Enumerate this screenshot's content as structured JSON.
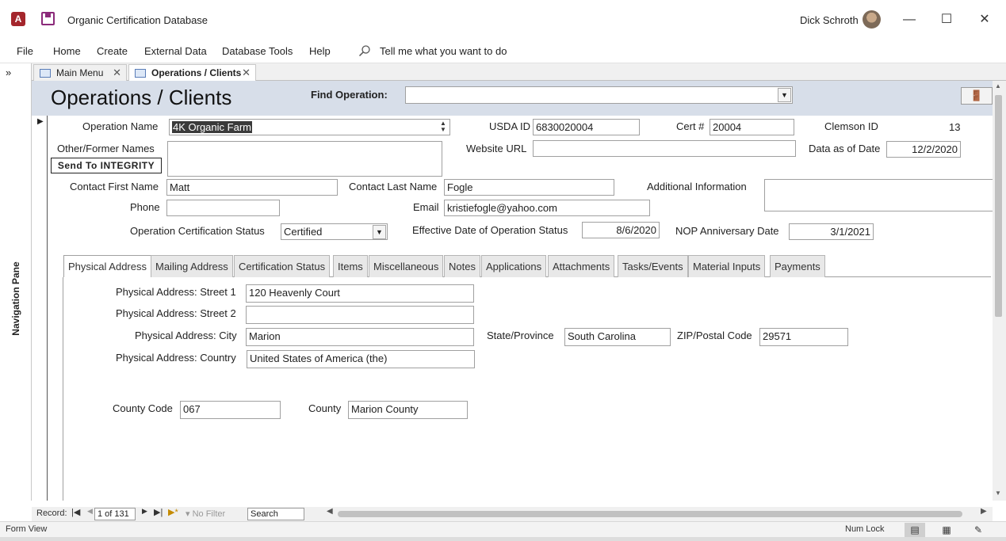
{
  "window": {
    "title": "Organic Certification Database",
    "user_name": "Dick Schroth",
    "app_icon_letter": "A"
  },
  "menu": {
    "items": [
      "File",
      "Home",
      "Create",
      "External Data",
      "Database Tools",
      "Help"
    ],
    "tell_me": "Tell me what you want to do"
  },
  "nav_pane": {
    "label": "Navigation Pane",
    "toggle": "»"
  },
  "doc_tabs": [
    {
      "label": "Main Menu",
      "active": false
    },
    {
      "label": "Operations / Clients",
      "active": true
    }
  ],
  "form": {
    "title": "Operations / Clients",
    "find_operation_label": "Find Operation:",
    "find_operation_value": ""
  },
  "record": {
    "operation_name_label": "Operation Name",
    "operation_name": "4K Organic Farm",
    "usda_id_label": "USDA ID",
    "usda_id": "6830020004",
    "cert_label": "Cert #",
    "cert": "20004",
    "clemson_id_label": "Clemson ID",
    "clemson_id": "13",
    "other_names_label": "Other/Former Names",
    "send_integrity_button": "Send To INTEGRITY",
    "other_names": "",
    "website_label": "Website URL",
    "website": "",
    "data_as_of_label": "Data as of Date",
    "data_as_of": "12/2/2020",
    "contact_first_label": "Contact First Name",
    "contact_first": "Matt",
    "contact_last_label": "Contact Last Name",
    "contact_last": "Fogle",
    "additional_info_label": "Additional Information",
    "additional_info": "",
    "phone_label": "Phone",
    "phone": "",
    "email_label": "Email",
    "email": "kristiefogle@yahoo.com",
    "cert_status_label": "Operation Certification Status",
    "cert_status": "Certified",
    "effective_date_label": "Effective Date of Operation Status",
    "effective_date": "8/6/2020",
    "nop_anniv_label": "NOP Anniversary Date",
    "nop_anniv": "3/1/2021"
  },
  "tabs": [
    "Physical Address",
    "Mailing Address",
    "Certification Status",
    "Items",
    "Miscellaneous",
    "Notes",
    "Applications",
    "Attachments",
    "Tasks/Events",
    "Material Inputs",
    "Payments"
  ],
  "physical_address": {
    "street1_label": "Physical Address: Street 1",
    "street1": "120 Heavenly Court",
    "street2_label": "Physical Address: Street 2",
    "street2": "",
    "city_label": "Physical Address: City",
    "city": "Marion",
    "state_label": "State/Province",
    "state": "South Carolina",
    "zip_label": "ZIP/Postal Code",
    "zip": "29571",
    "country_label": "Physical Address: Country",
    "country": "United States of America (the)",
    "county_code_label": "County Code",
    "county_code": "067",
    "county_label": "County",
    "county": "Marion County"
  },
  "record_nav": {
    "label": "Record:",
    "position": "1 of 131",
    "filter": "No Filter",
    "search": "Search"
  },
  "status_bar": {
    "left": "Form View",
    "num_lock": "Num Lock"
  }
}
